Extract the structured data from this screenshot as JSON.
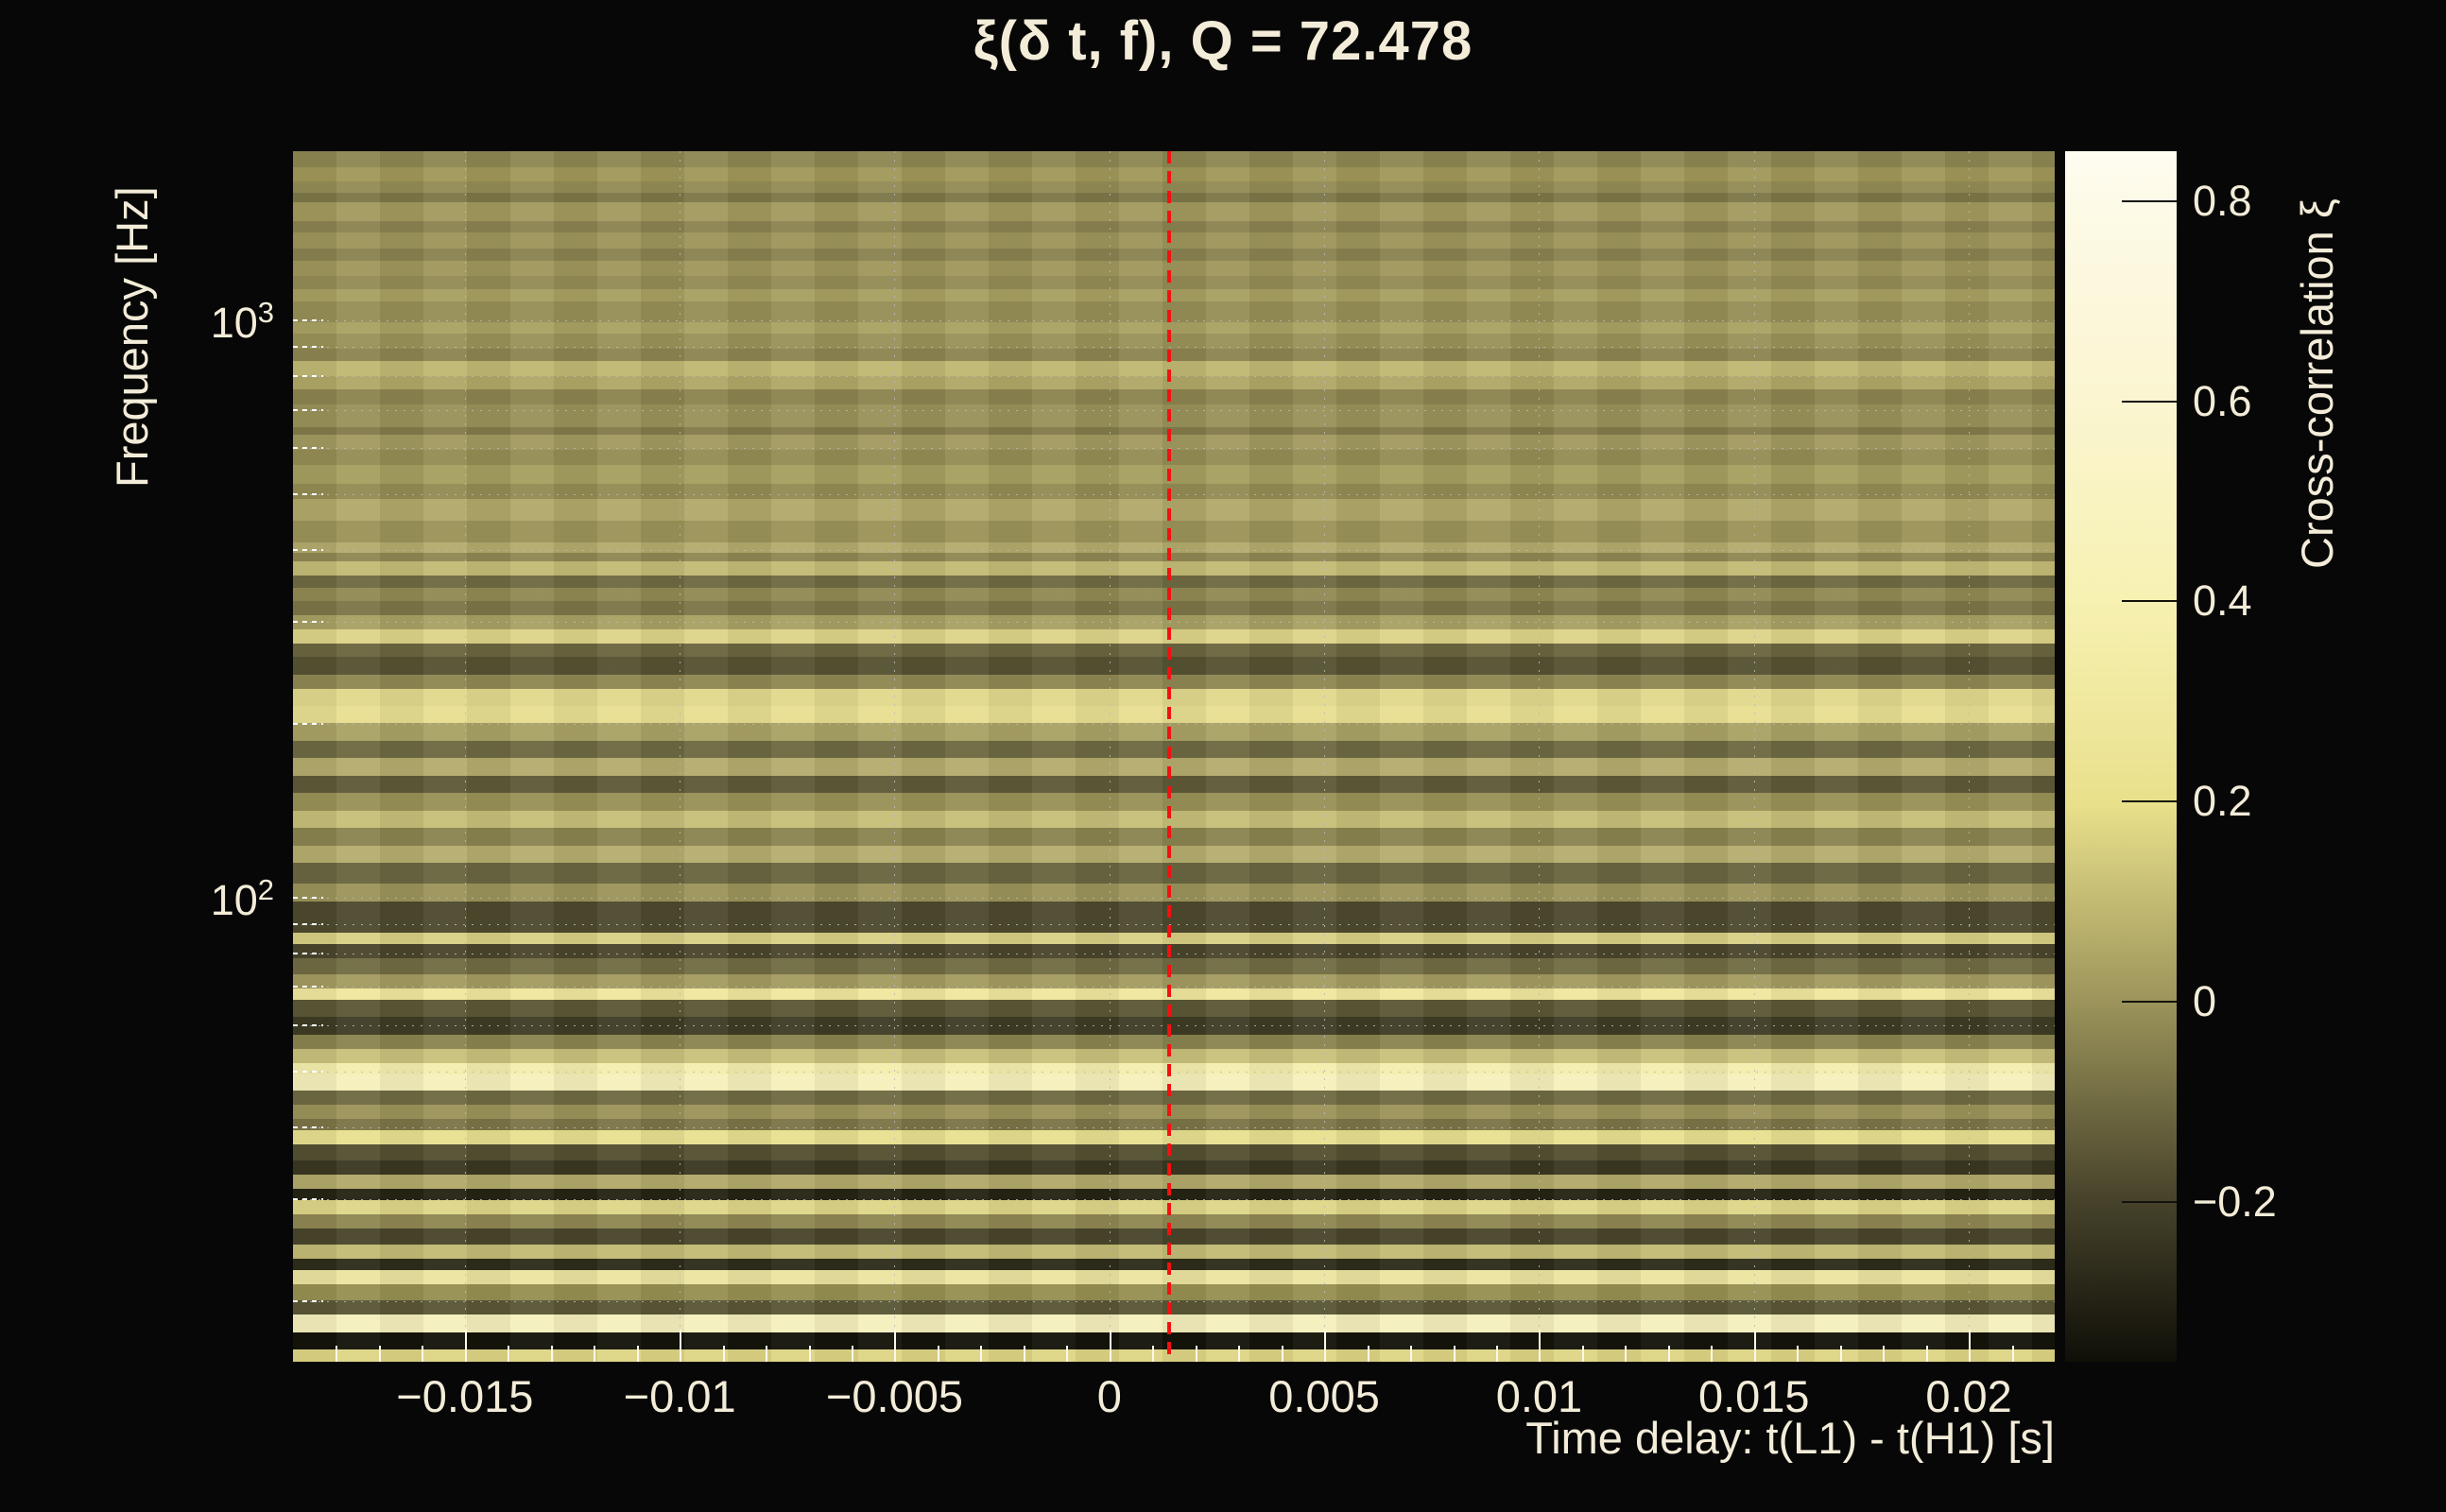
{
  "title": "ξ(δ t, f), Q = 72.478",
  "colors": {
    "background": "#070707",
    "text": "#f3ecd8",
    "marker_line": "#f21111",
    "grid": "#b9b9b9",
    "tick": "#fdf8ea"
  },
  "chart_data": {
    "type": "heatmap",
    "title": "ξ(δ t, f), Q = 72.478",
    "q_value": 72.478,
    "xlabel": "Time delay: t(L1) - t(H1) [s]",
    "ylabel": "Frequency [Hz]",
    "colorbar_label": "Cross-correlation ξ",
    "x_range_s": [
      -0.019,
      0.022
    ],
    "y_range_hz": [
      15.7,
      1963
    ],
    "y_scale": "log",
    "z_range": [
      -0.36,
      0.85
    ],
    "marker_line_x_s": 0.0014,
    "x_major_ticks": [
      {
        "t": -0.015,
        "label": "−0.015"
      },
      {
        "t": -0.01,
        "label": "−0.01"
      },
      {
        "t": -0.005,
        "label": "−0.005"
      },
      {
        "t": 0,
        "label": "0"
      },
      {
        "t": 0.005,
        "label": "0.005"
      },
      {
        "t": 0.01,
        "label": "0.01"
      },
      {
        "t": 0.015,
        "label": "0.015"
      },
      {
        "t": 0.02,
        "label": "0.02"
      }
    ],
    "x_minor_step_s": 0.001,
    "y_major_ticks": [
      {
        "hz": 1000,
        "base": "10",
        "exp": "3"
      },
      {
        "hz": 100,
        "base": "10",
        "exp": "2"
      }
    ],
    "y_minor_ticks_hz": [
      20,
      30,
      40,
      50,
      60,
      70,
      80,
      90,
      200,
      300,
      400,
      500,
      600,
      700,
      800,
      900
    ],
    "colorbar_ticks": [
      {
        "v": 0.8,
        "label": "0.8"
      },
      {
        "v": 0.6,
        "label": "0.6"
      },
      {
        "v": 0.4,
        "label": "0.4"
      },
      {
        "v": 0.2,
        "label": "0.2"
      },
      {
        "v": 0,
        "label": "0"
      },
      {
        "v": -0.2,
        "label": "−0.2"
      }
    ],
    "colorbar_stops": [
      {
        "p": 0,
        "c": "#fffdf1"
      },
      {
        "p": 4,
        "c": "#fdfae8"
      },
      {
        "p": 21,
        "c": "#fbf5d0"
      },
      {
        "p": 37,
        "c": "#f7f1b2"
      },
      {
        "p": 54,
        "c": "#e9e08b"
      },
      {
        "p": 70,
        "c": "#9d955b"
      },
      {
        "p": 87,
        "c": "#45412a"
      },
      {
        "p": 100,
        "c": "#100f08"
      }
    ],
    "stripes": [
      [
        14,
        "#8d8752"
      ],
      [
        12,
        "#a09859"
      ],
      [
        10,
        "#948c55"
      ],
      [
        8,
        "#7d774a"
      ],
      [
        16,
        "#a29a5e"
      ],
      [
        10,
        "#8b8350"
      ],
      [
        14,
        "#9d955a"
      ],
      [
        10,
        "#8a8250"
      ],
      [
        13,
        "#9f975c"
      ],
      [
        12,
        "#948c55"
      ],
      [
        10,
        "#a8a062"
      ],
      [
        18,
        "#978f57"
      ],
      [
        10,
        "#aaa263"
      ],
      [
        13,
        "#9a9259"
      ],
      [
        10,
        "#8d8551"
      ],
      [
        13,
        "#c0b873"
      ],
      [
        12,
        "#b0a867"
      ],
      [
        13,
        "#8c844f"
      ],
      [
        19,
        "#9a925a"
      ],
      [
        7,
        "#837b4a"
      ],
      [
        13,
        "#a29a60"
      ],
      [
        13,
        "#958d55"
      ],
      [
        16,
        "#a79f60"
      ],
      [
        13,
        "#948c54"
      ],
      [
        19,
        "#b1a96a"
      ],
      [
        18,
        "#9b9358"
      ],
      [
        9,
        "#b3ab6c"
      ],
      [
        8,
        "#8f8752"
      ],
      [
        12,
        "#c3bb76"
      ],
      [
        10,
        "#6f6a42"
      ],
      [
        12,
        "#918a54"
      ],
      [
        12,
        "#7c7648"
      ],
      [
        12,
        "#a9a164"
      ],
      [
        12,
        "#ddd489"
      ],
      [
        12,
        "#6b663f"
      ],
      [
        15,
        "#565233"
      ],
      [
        12,
        "#8f8752"
      ],
      [
        15,
        "#e2d98d"
      ],
      [
        15,
        "#e8df92"
      ],
      [
        15,
        "#aaa265"
      ],
      [
        15,
        "#6e6942"
      ],
      [
        15,
        "#b4ac6d"
      ],
      [
        15,
        "#5f5b38"
      ],
      [
        15,
        "#999157"
      ],
      [
        15,
        "#c7bf79"
      ],
      [
        15,
        "#8a8450"
      ],
      [
        15,
        "#b5ad6e"
      ],
      [
        18,
        "#6a6540"
      ],
      [
        15,
        "#9c945a"
      ],
      [
        27,
        "#4e4a2e"
      ],
      [
        10,
        "#d8cf85"
      ],
      [
        12,
        "#4a462c"
      ],
      [
        14,
        "#716c42"
      ],
      [
        12,
        "#a39b60"
      ],
      [
        10,
        "#efe79e"
      ],
      [
        14,
        "#5c5836"
      ],
      [
        16,
        "#3f3c25"
      ],
      [
        12,
        "#8a8450"
      ],
      [
        12,
        "#c9c17b"
      ],
      [
        10,
        "#f4eead"
      ],
      [
        14,
        "#f6f0bc"
      ],
      [
        12,
        "#6f6a42"
      ],
      [
        12,
        "#9c945a"
      ],
      [
        10,
        "#7d7548"
      ],
      [
        12,
        "#e8e090"
      ],
      [
        14,
        "#545031"
      ],
      [
        12,
        "#3a3722"
      ],
      [
        12,
        "#b2aa6a"
      ],
      [
        10,
        "#262414"
      ],
      [
        12,
        "#ded688"
      ],
      [
        12,
        "#8f8752"
      ],
      [
        14,
        "#4a462c"
      ],
      [
        12,
        "#c3bb76"
      ],
      [
        10,
        "#2e2c1a"
      ],
      [
        12,
        "#ece4a0"
      ],
      [
        14,
        "#979052"
      ],
      [
        12,
        "#5a5636"
      ],
      [
        16,
        "#f5efbe"
      ],
      [
        14,
        "#15140b"
      ],
      [
        11,
        "#ded584"
      ]
    ]
  }
}
